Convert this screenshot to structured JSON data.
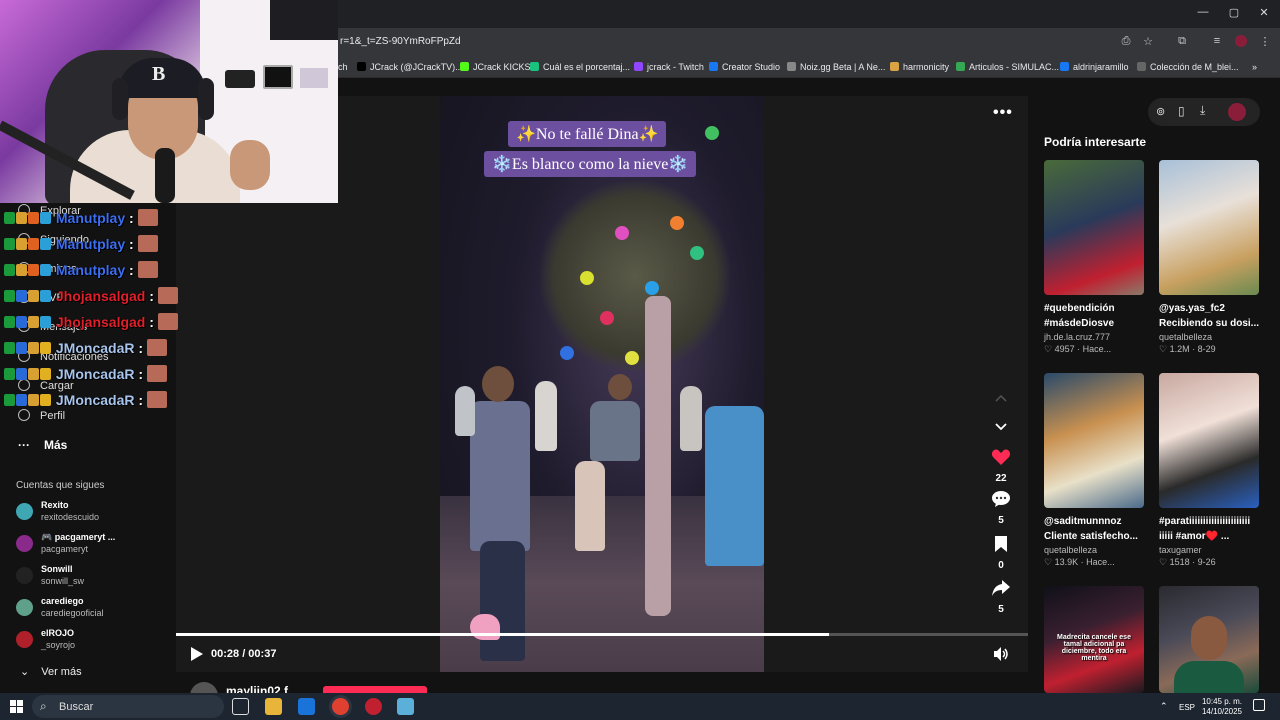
{
  "browser": {
    "url": "r=1&_t=ZS-90YmRoFPpZd",
    "window_controls": {
      "minimize": "—",
      "maximize": "▢",
      "close": "✕"
    },
    "bookmarks": [
      {
        "label": "ch",
        "color": "#444444"
      },
      {
        "label": "JCrack (@JCrackTV)...",
        "color": "#000000"
      },
      {
        "label": "JCrack KICKS",
        "color": "#53fc18"
      },
      {
        "label": "Cuál es el porcentaj...",
        "color": "#19c37d"
      },
      {
        "label": "jcrack - Twitch",
        "color": "#9146ff"
      },
      {
        "label": "Creator Studio",
        "color": "#1877f2"
      },
      {
        "label": "Noiz.gg Beta | A Ne...",
        "color": "#888888"
      },
      {
        "label": "harmonicity",
        "color": "#d9a441"
      },
      {
        "label": "Articulos - SIMULAC...",
        "color": "#34a853"
      },
      {
        "label": "aldrinjaramillo",
        "color": "#1877f2"
      },
      {
        "label": "Colección de M_blei...",
        "color": "#666666"
      }
    ],
    "bookmarks_more": "»"
  },
  "sidebar": {
    "nav": [
      {
        "label": "Explorar",
        "icon": "compass-icon"
      },
      {
        "label": "Siguiendo",
        "icon": "following-icon"
      },
      {
        "label": "Amigos",
        "icon": "friends-icon"
      },
      {
        "label": "LIVE",
        "icon": "live-icon"
      },
      {
        "label": "Mensajes",
        "icon": "messages-icon"
      },
      {
        "label": "Notificaciones",
        "icon": "bell-icon"
      },
      {
        "label": "Cargar",
        "icon": "upload-icon"
      },
      {
        "label": "Perfil",
        "icon": "profile-icon"
      }
    ],
    "more": "Más",
    "following_title": "Cuentas que sigues",
    "following": [
      {
        "name": "Rexito",
        "handle": "rexitodescuido",
        "color": "#3fa6b4"
      },
      {
        "name": "🎮 pacgameryt ...",
        "handle": "pacgameryt",
        "color": "#8a2a8a"
      },
      {
        "name": "Sonwill",
        "handle": "sonwill_sw",
        "color": "#222222"
      },
      {
        "name": "carediego",
        "handle": "carediegooficial",
        "color": "#5fa08a"
      },
      {
        "name": "elROJO",
        "handle": "_soyrojo",
        "color": "#b0202a"
      }
    ],
    "see_more": "Ver más"
  },
  "chat": [
    {
      "user": "Manutplay",
      "color": "#3c6ef0",
      "sep": ":"
    },
    {
      "user": "Manutplay",
      "color": "#3c6ef0",
      "sep": ":"
    },
    {
      "user": "Manutplay",
      "color": "#3c6ef0",
      "sep": ":"
    },
    {
      "user": "Jhojansalgad",
      "color": "#e0202a",
      "sep": ":"
    },
    {
      "user": "Jhojansalgad",
      "color": "#e0202a",
      "sep": ":"
    },
    {
      "user": "JMoncadaR",
      "color": "#a7c4ec",
      "sep": ":"
    },
    {
      "user": "JMoncadaR",
      "color": "#a7c4ec",
      "sep": ":"
    },
    {
      "user": "JMoncadaR",
      "color": "#a7c4ec",
      "sep": ":"
    }
  ],
  "video": {
    "caption_line1": "✨No te fallé Dina✨",
    "caption_line2": "❄️Es blanco como la nieve❄️",
    "time": "00:28 / 00:37",
    "progress": 0.767,
    "more": "•••",
    "likes": "22",
    "comments": "5",
    "saves": "0",
    "shares": "5",
    "author": "mayliin02.f"
  },
  "recommended": {
    "title": "Podría interesarte",
    "items": [
      {
        "line1": "#quebendición",
        "line2": "#másdeDiosve",
        "author": "jh.de.la.cruz.777",
        "stats": "♡ 4957 · Hace..."
      },
      {
        "line1": "@yas.yas_fc2",
        "line2": "Recibiendo su dosi...",
        "author": "quetalbelleza",
        "stats": "♡ 1.2M · 8-29"
      },
      {
        "line1": "@saditmunnnoz",
        "line2": "Cliente satisfecho...",
        "author": "quetalbelleza",
        "stats": "♡ 13.9K · Hace..."
      },
      {
        "line1": "#paratiiiiiiiiiiiiiiiiiiiiii",
        "line2": "iiiii #amor♥️ ...",
        "author": "taxugamer",
        "stats": "♡ 1518 · 9-26"
      },
      {
        "overlay": "Madrecita cancele ese tamal adicional pa diciembre, todo era mentira"
      }
    ]
  },
  "taskbar": {
    "search": "Buscar",
    "lang": "ESP",
    "time": "10:45 p. m.",
    "date": "14/10/2025"
  }
}
